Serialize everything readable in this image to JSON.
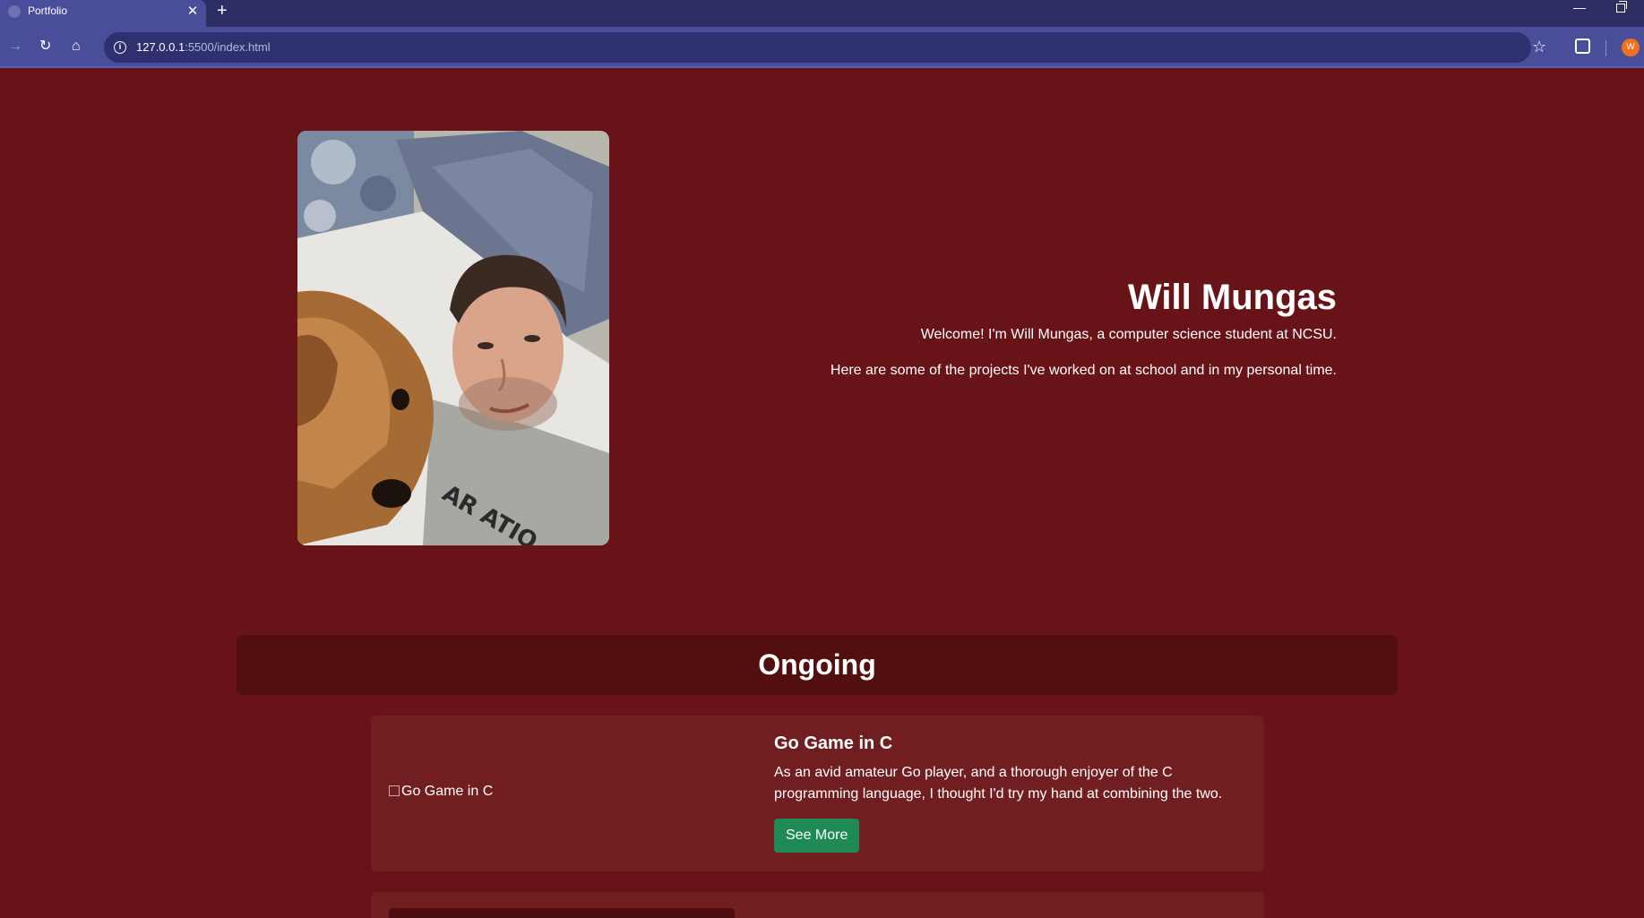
{
  "browser": {
    "tab_title": "Portfolio",
    "new_tab_label": "+",
    "tab_close_label": "✕",
    "url_host": "127.0.0.1",
    "url_path": ":5500/index.html",
    "profile_initial": "W",
    "accent": "#4a4d9a"
  },
  "hero": {
    "name": "Will Mungas",
    "intro": "Welcome! I'm Will Mungas, a computer science student at NCSU.",
    "subtitle": "Here are some of the projects I've worked on at school and in my personal time."
  },
  "sections": {
    "ongoing_title": "Ongoing"
  },
  "projects": [
    {
      "image_alt": "Go Game in C",
      "title": "Go Game in C",
      "description": "As an avid amateur Go player, and a thorough enjoyer of the C programming language, I thought I'd try my hand at combining the two.",
      "button_label": "See More"
    }
  ],
  "colors": {
    "page_background": "#681317",
    "section_header": "#530e10",
    "card_background": "#711e21",
    "button": "#1f8a55"
  }
}
